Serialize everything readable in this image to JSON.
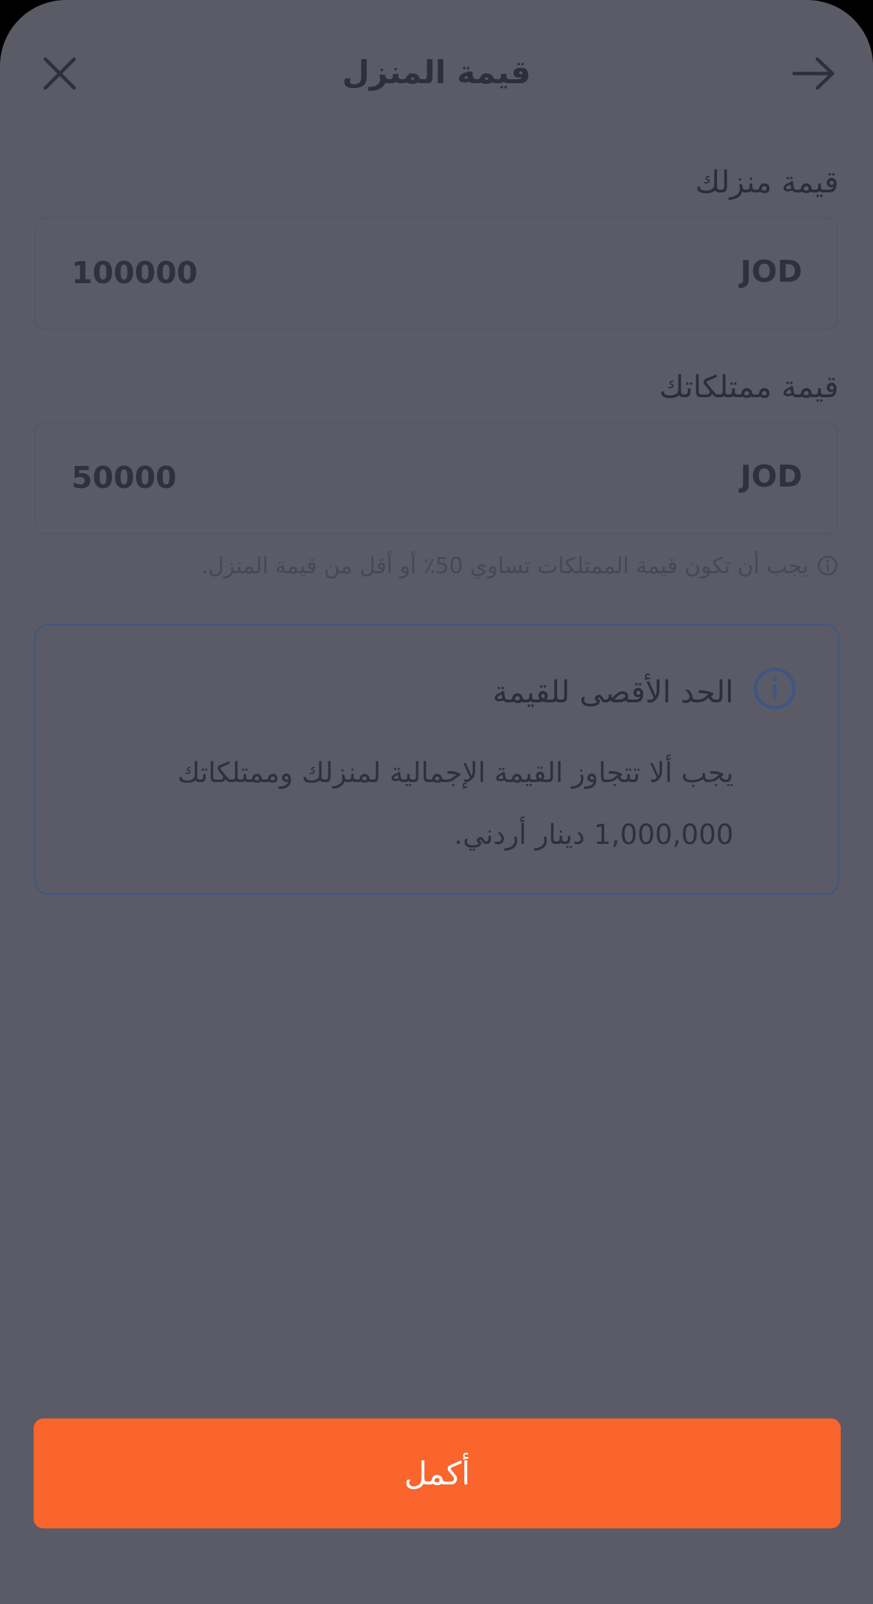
{
  "header": {
    "title": "قيمة المنزل",
    "close_icon": "close-icon",
    "back_icon": "arrow-right-icon"
  },
  "home_value": {
    "label": "قيمة منزلك",
    "value": "100000",
    "currency": "JOD"
  },
  "contents_value": {
    "label": "قيمة ممتلكاتك",
    "value": "50000",
    "currency": "JOD",
    "hint": "يجب أن تكون قيمة الممتلكات تساوي 50٪ أو أقل من قيمة المنزل."
  },
  "info_card": {
    "title": "الحد الأقصى للقيمة",
    "body": "يجب ألا تتجاوز القيمة الإجمالية لمنزلك وممتلكاتك 1,000,000 دينار أردني.",
    "icon": "info-icon"
  },
  "footer": {
    "continue_label": "أكمل"
  },
  "colors": {
    "overlay_background": "#5b5b67",
    "accent": "#f9652c",
    "info_border": "#405680"
  }
}
